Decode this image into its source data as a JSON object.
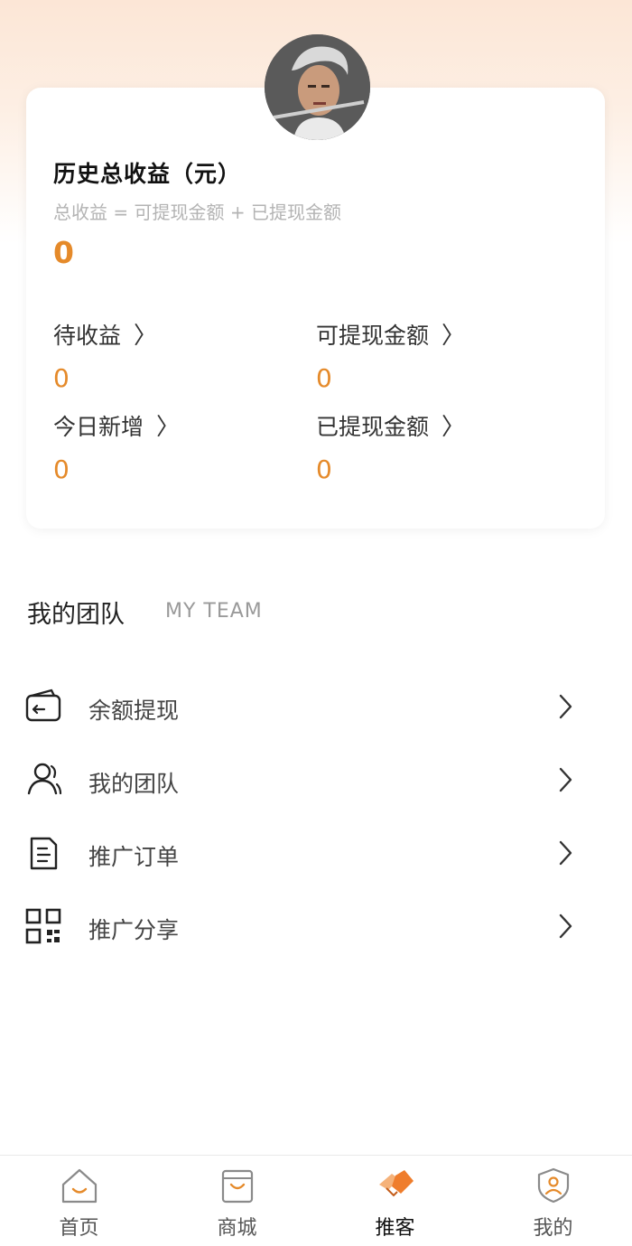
{
  "earnings_card": {
    "title": "历史总收益（元）",
    "formula": "总收益 = 可提现金额 + 已提现金额",
    "total": "0",
    "stats": [
      {
        "label": "待收益",
        "value": "0"
      },
      {
        "label": "可提现金额",
        "value": "0"
      },
      {
        "label": "今日新增",
        "value": "0"
      },
      {
        "label": "已提现金额",
        "value": "0"
      }
    ]
  },
  "team": {
    "title": "我的团队",
    "subtitle": "MY TEAM"
  },
  "menu": [
    {
      "label": "余额提现",
      "icon": "wallet-icon"
    },
    {
      "label": "我的团队",
      "icon": "team-icon"
    },
    {
      "label": "推广订单",
      "icon": "order-icon"
    },
    {
      "label": "推广分享",
      "icon": "qrcode-icon"
    }
  ],
  "tabbar": [
    {
      "label": "首页",
      "icon": "home-icon",
      "active": false
    },
    {
      "label": "商城",
      "icon": "shop-bag-icon",
      "active": false
    },
    {
      "label": "推客",
      "icon": "handshake-icon",
      "active": true
    },
    {
      "label": "我的",
      "icon": "profile-icon",
      "active": false
    }
  ],
  "colors": {
    "accent": "#e58a2a",
    "gradient_top": "#fce6d6"
  }
}
